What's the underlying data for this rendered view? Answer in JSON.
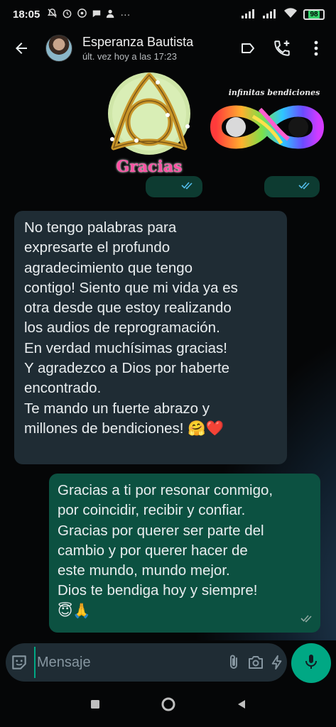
{
  "status_bar": {
    "time": "18:05",
    "battery": "98",
    "icons": [
      "mute-icon",
      "alarm-icon",
      "whatsapp-icon",
      "chat-icon",
      "person-icon",
      "more-dots",
      "signal-icon",
      "signal-icon",
      "wifi-icon",
      "battery-icon"
    ]
  },
  "header": {
    "contact_name": "Esperanza Bautista",
    "last_seen": "últ. vez hoy a las 17:23",
    "icons": [
      "back-arrow-icon",
      "label-icon",
      "add-call-icon",
      "more-vert-icon"
    ]
  },
  "stickers": [
    {
      "name": "sticker-gracias",
      "text": "Gracias"
    },
    {
      "name": "sticker-infinitas-bendiciones",
      "text": "infinitas bendiciones"
    }
  ],
  "messages": {
    "incoming": {
      "text": "No tengo palabras para\nexpresarte el profundo\nagradecimiento que tengo\ncontigo! Siento que mi vida ya es\notra desde que estoy realizando\nlos audios de reprogramación.\nEn verdad muchísimas gracias!\nY agradezco a Dios por haberte\nencontrado.\nTe mando un fuerte abrazo y\nmillones de bendiciones! 🤗❤️"
    },
    "outgoing": {
      "text": "Gracias a ti por resonar conmigo,\npor coincidir, recibir y confiar.\nGracias por querer ser parte del\ncambio y por querer hacer de\neste mundo, mundo mejor.\nDios te bendiga hoy y siempre!\n😇🙏"
    }
  },
  "composer": {
    "placeholder": "Mensaje",
    "icons": [
      "sticker-icon",
      "attach-icon",
      "camera-icon",
      "lightning-icon",
      "mic-icon"
    ]
  },
  "colors": {
    "incoming_bubble": "#1f2c34",
    "outgoing_bubble": "#0c5141",
    "accent": "#00a884",
    "read_ticks": "#53bdeb"
  }
}
